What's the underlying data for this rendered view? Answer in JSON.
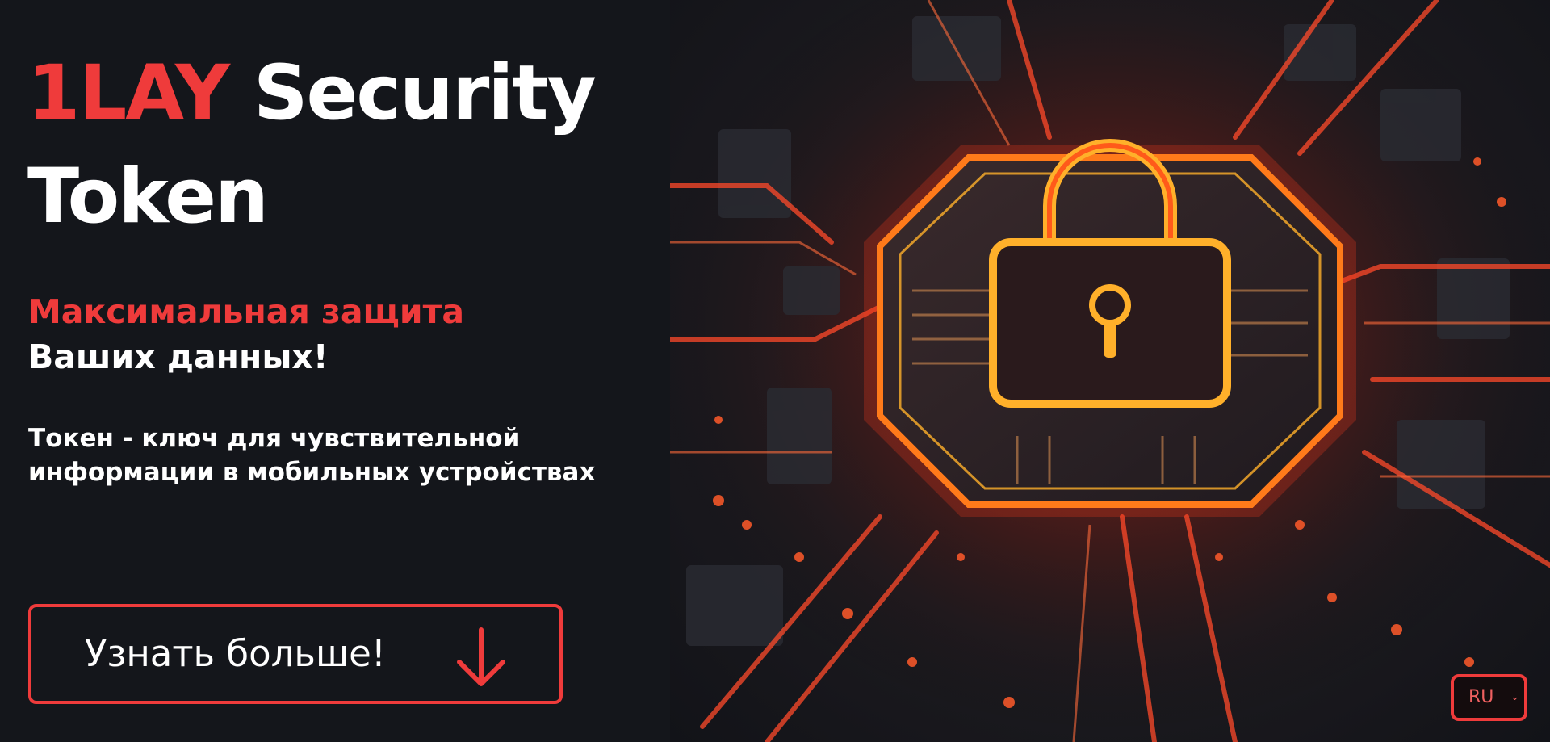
{
  "hero": {
    "title_brand": "1LAY",
    "title_rest_line1": "Security",
    "title_line2": "Token",
    "subtitle_red": "Максимальная защита",
    "subtitle_white": "Ваших данных!",
    "desc_line1": "Токен - ключ для чувствительной",
    "desc_line2": "информации в мобильных устройствах"
  },
  "cta": {
    "label": "Узнать больше!",
    "icon": "arrow-down-icon"
  },
  "image": {
    "icon": "circuit-lock-illustration"
  },
  "language": {
    "selected": "RU",
    "icon": "chevron-down-icon"
  },
  "colors": {
    "accent": "#ef3b3b",
    "background": "#14161b",
    "text": "#ffffff"
  }
}
